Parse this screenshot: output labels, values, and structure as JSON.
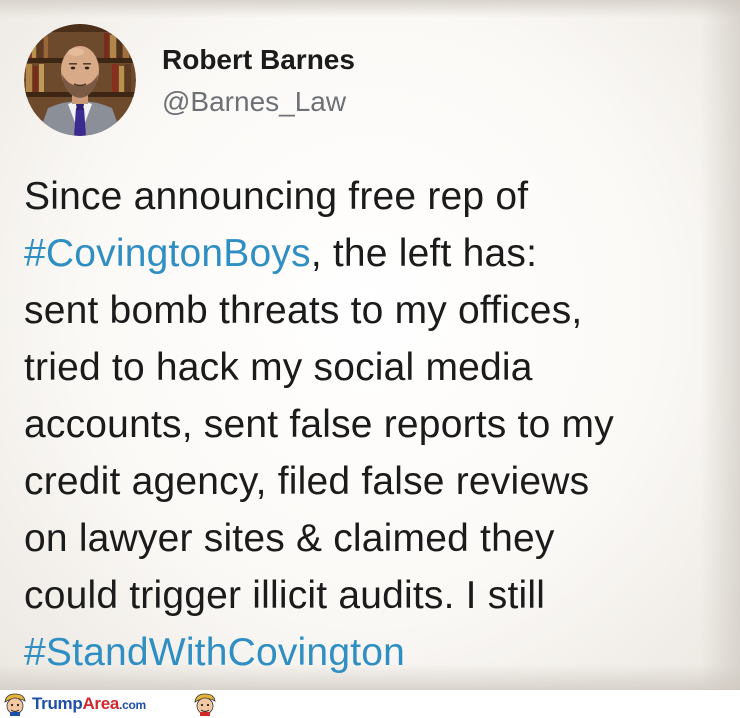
{
  "tweet": {
    "author": {
      "display_name": "Robert Barnes",
      "handle": "@Barnes_Law",
      "avatar_icon": "profile-photo"
    },
    "text_lines": [
      [
        {
          "text": "Since announcing free rep of",
          "hashtag": false
        }
      ],
      [
        {
          "text": "#CovingtonBoys",
          "hashtag": true
        },
        {
          "text": ", the left has:",
          "hashtag": false
        }
      ],
      [
        {
          "text": "sent bomb threats to my offices,",
          "hashtag": false
        }
      ],
      [
        {
          "text": "tried to hack my social media",
          "hashtag": false
        }
      ],
      [
        {
          "text": "accounts, sent false reports to my",
          "hashtag": false
        }
      ],
      [
        {
          "text": "credit agency, filed false reviews",
          "hashtag": false
        }
      ],
      [
        {
          "text": "on lawyer sites & claimed they",
          "hashtag": false
        }
      ],
      [
        {
          "text": "could trigger illicit audits. I still",
          "hashtag": false
        }
      ],
      [
        {
          "text": "#StandWithCovington",
          "hashtag": true
        }
      ]
    ],
    "hashtag_color": "#2f8fc3",
    "text_color": "#1b1b1b"
  },
  "watermark": {
    "brand_part1": "Trump",
    "brand_part2": "Area",
    "brand_part3": ".com",
    "mascot_icon": "cartoon-face-icon",
    "colors": {
      "blue": "#1f4fa8",
      "red": "#d0282d"
    }
  }
}
